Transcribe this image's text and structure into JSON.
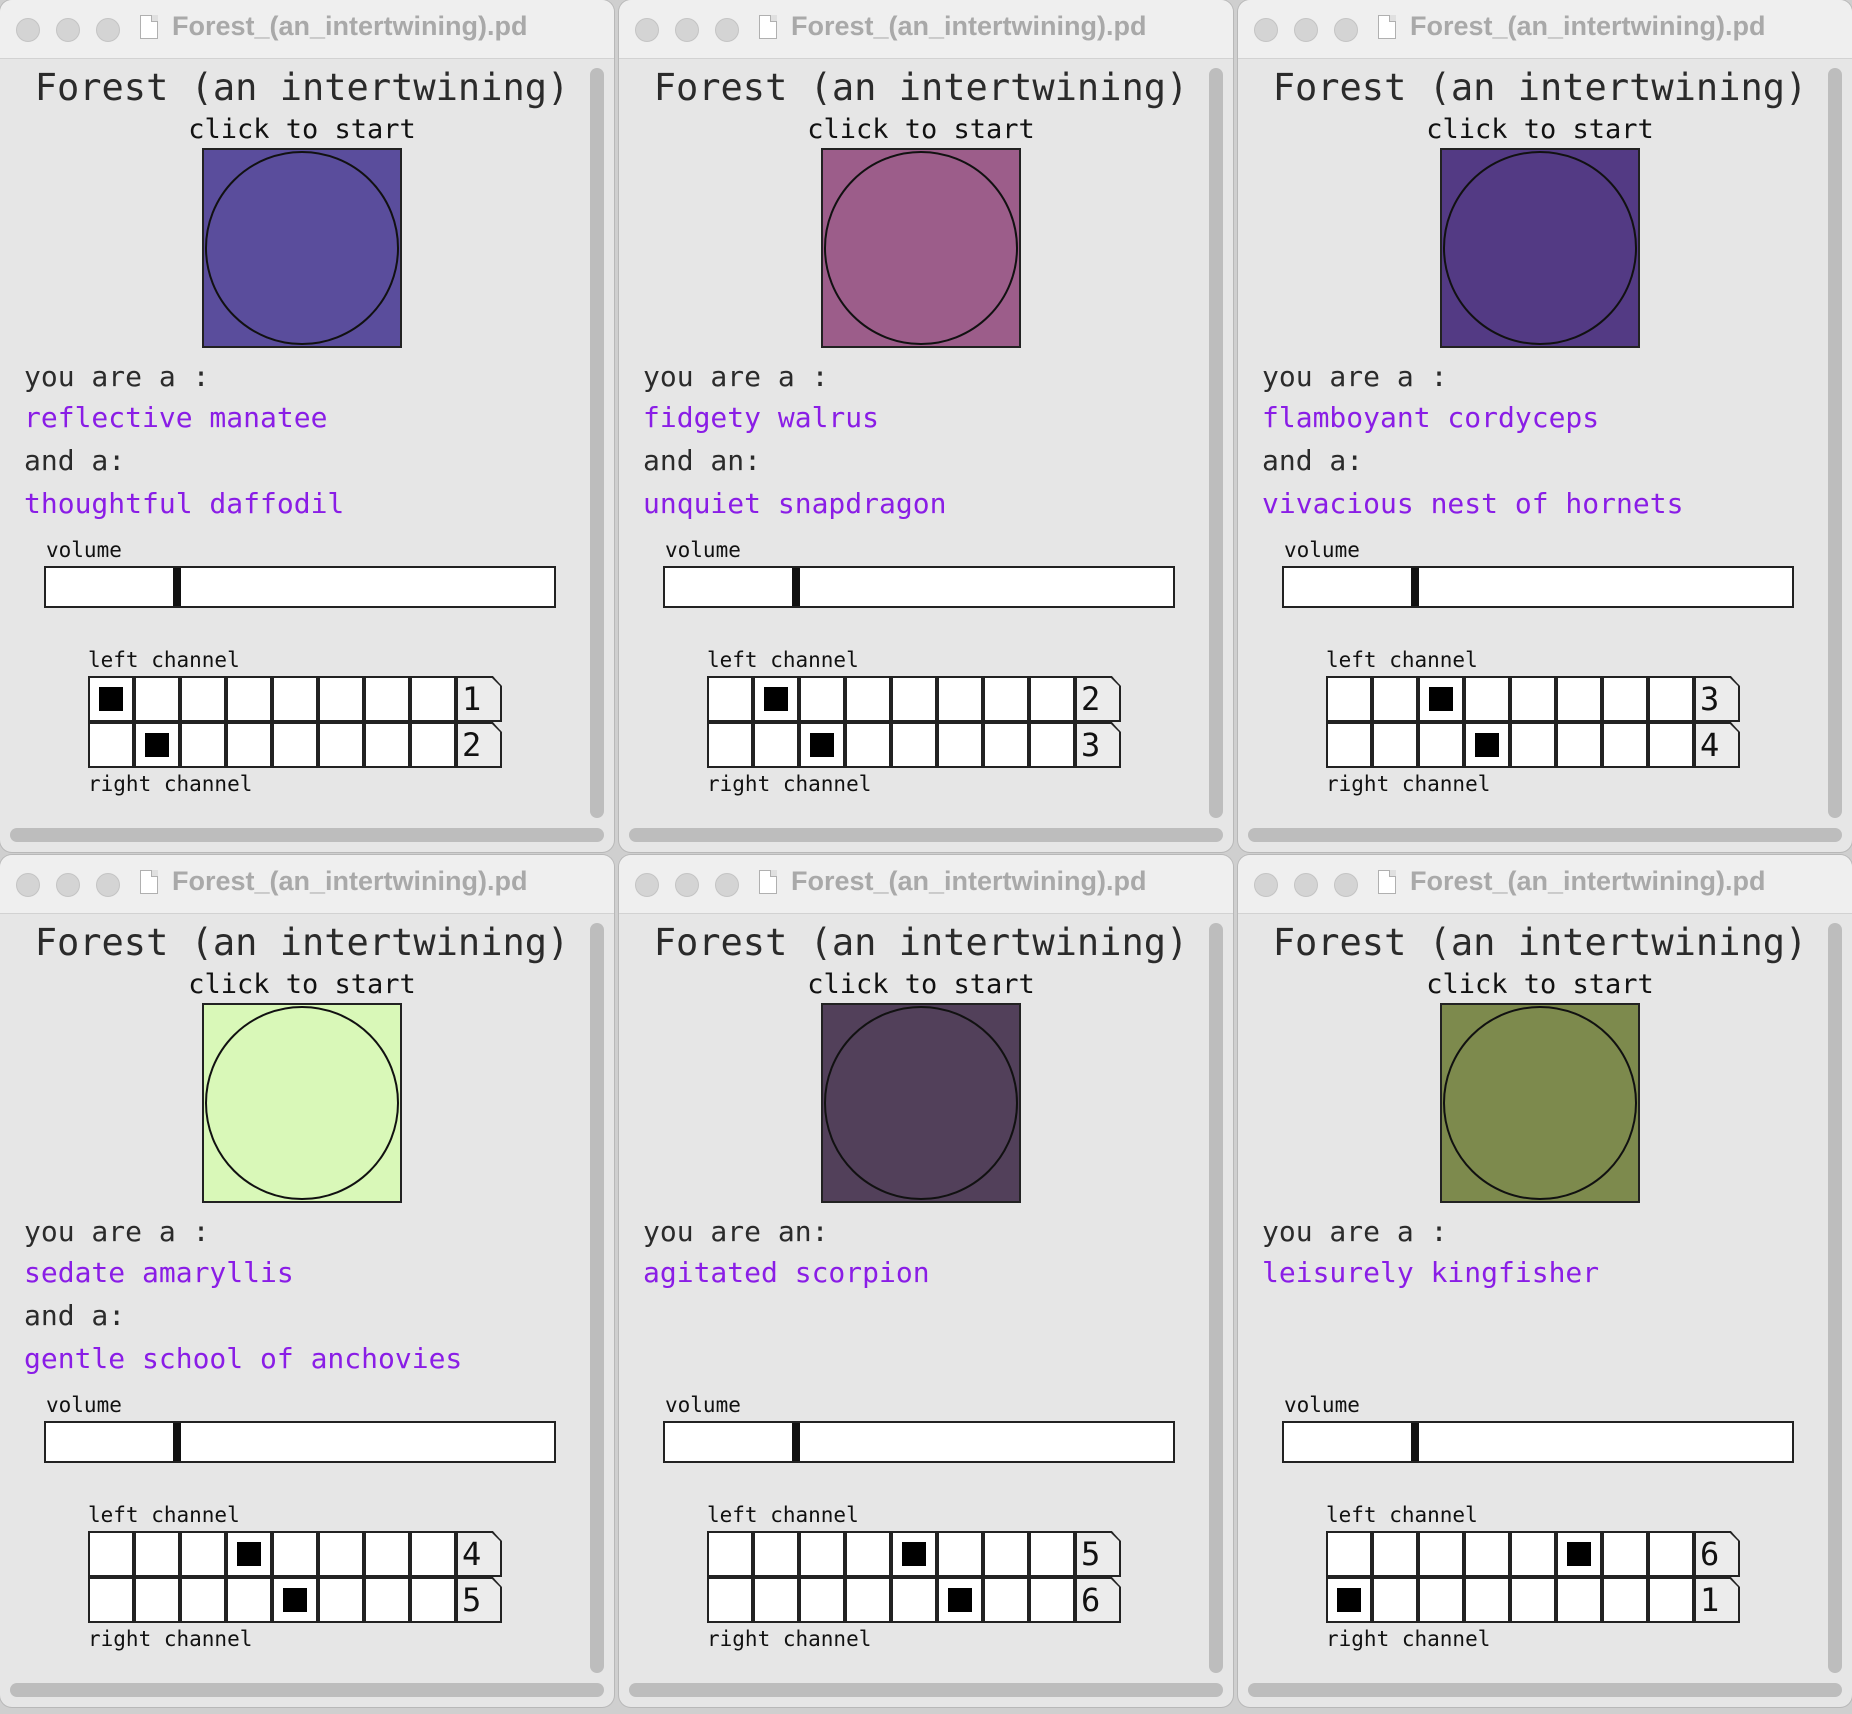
{
  "windows": [
    {
      "window_title": "Forest_(an_intertwining).pd",
      "app_title": "Forest (an intertwining)",
      "start_label": "click to start",
      "start_color": "#5a4d9c",
      "you_label": "you are a :",
      "animal": "reflective manatee",
      "and_label": "and a:",
      "plant": "thoughtful daffodil",
      "volume_label": "volume",
      "volume_value": 0.25,
      "left_channel_label": "left channel",
      "right_channel_label": "right channel",
      "left_selected": 0,
      "right_selected": 1,
      "left_number": "1",
      "right_number": "2"
    },
    {
      "window_title": "Forest_(an_intertwining).pd",
      "app_title": "Forest (an intertwining)",
      "start_label": "click to start",
      "start_color": "#9c5d8a",
      "you_label": "you are a :",
      "animal": "fidgety walrus",
      "and_label": "and an:",
      "plant": "unquiet snapdragon",
      "volume_label": "volume",
      "volume_value": 0.25,
      "left_channel_label": "left channel",
      "right_channel_label": "right channel",
      "left_selected": 1,
      "right_selected": 2,
      "left_number": "2",
      "right_number": "3"
    },
    {
      "window_title": "Forest_(an_intertwining).pd",
      "app_title": "Forest (an intertwining)",
      "start_label": "click to start",
      "start_color": "#533a84",
      "you_label": "you are a :",
      "animal": "flamboyant cordyceps",
      "and_label": "and a:",
      "plant": "vivacious nest of hornets",
      "volume_label": "volume",
      "volume_value": 0.25,
      "left_channel_label": "left channel",
      "right_channel_label": "right channel",
      "left_selected": 2,
      "right_selected": 3,
      "left_number": "3",
      "right_number": "4"
    },
    {
      "window_title": "Forest_(an_intertwining).pd",
      "app_title": "Forest (an intertwining)",
      "start_label": "click to start",
      "start_color": "#d9f8b8",
      "you_label": "you are a :",
      "animal": "sedate amaryllis",
      "and_label": "and a:",
      "plant": "gentle school of anchovies",
      "volume_label": "volume",
      "volume_value": 0.25,
      "left_channel_label": "left channel",
      "right_channel_label": "right channel",
      "left_selected": 3,
      "right_selected": 4,
      "left_number": "4",
      "right_number": "5"
    },
    {
      "window_title": "Forest_(an_intertwining).pd",
      "app_title": "Forest (an intertwining)",
      "start_label": "click to start",
      "start_color": "#52405a",
      "you_label": "you are an:",
      "animal": "agitated scorpion",
      "and_label": "",
      "plant": "",
      "volume_label": "volume",
      "volume_value": 0.25,
      "left_channel_label": "left channel",
      "right_channel_label": "right channel",
      "left_selected": 4,
      "right_selected": 5,
      "left_number": "5",
      "right_number": "6"
    },
    {
      "window_title": "Forest_(an_intertwining).pd",
      "app_title": "Forest (an intertwining)",
      "start_label": "click to start",
      "start_color": "#7d8a4d",
      "you_label": "you are a :",
      "animal": "leisurely kingfisher",
      "and_label": "",
      "plant": "",
      "volume_label": "volume",
      "volume_value": 0.25,
      "left_channel_label": "left channel",
      "right_channel_label": "right channel",
      "left_selected": 5,
      "right_selected": 0,
      "left_number": "6",
      "right_number": "1"
    }
  ]
}
